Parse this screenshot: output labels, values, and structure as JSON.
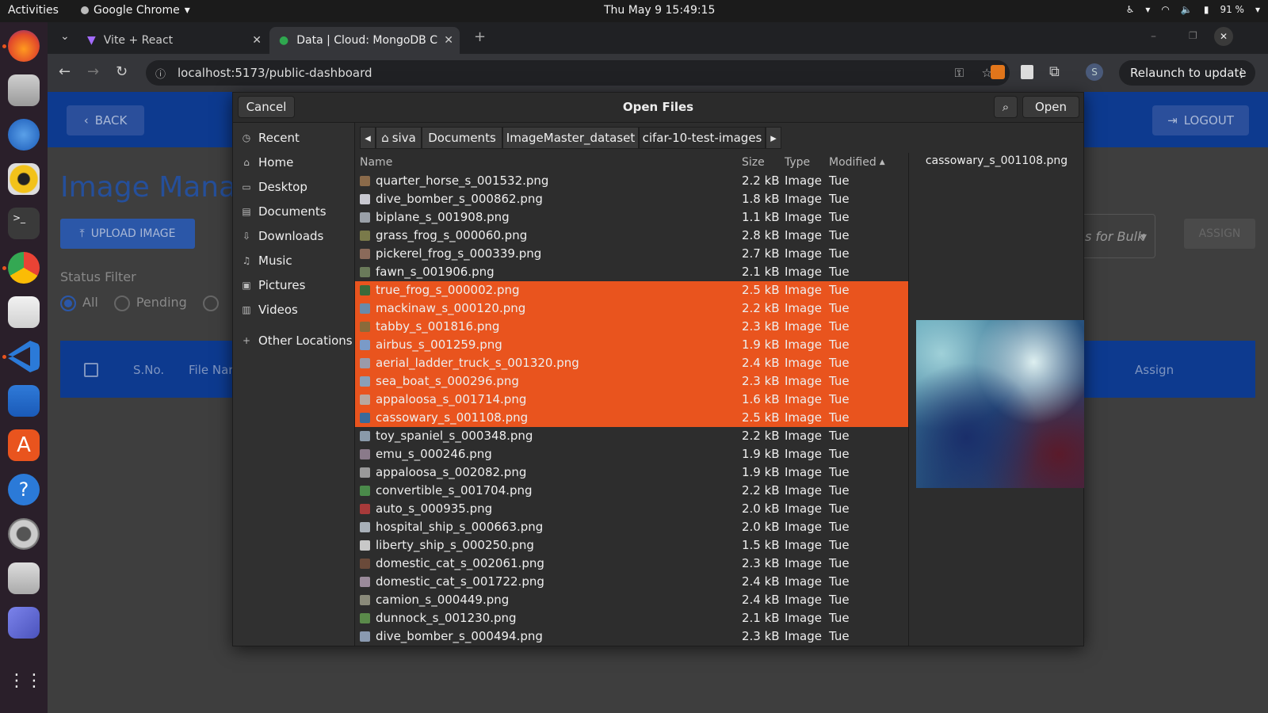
{
  "topbar": {
    "activities": "Activities",
    "app_name": "Google Chrome",
    "clock": "Thu May 9  15:49:15",
    "battery": "91 %"
  },
  "dock": {
    "apps": [
      "firefox",
      "files",
      "thunderbird",
      "rhythmbox",
      "terminal",
      "chrome",
      "screenshot-viewer",
      "vscode",
      "libreoffice-writer",
      "app-center",
      "help",
      "settings",
      "magnifier",
      "teams",
      "show-apps"
    ]
  },
  "chrome": {
    "tabs": [
      {
        "title": "Vite + React"
      },
      {
        "title": "Data | Cloud: MongoDB C"
      }
    ],
    "url": "localhost:5173/public-dashboard",
    "relaunch_label": "Relaunch to update",
    "profile_initial": "S"
  },
  "page": {
    "back_label": "BACK",
    "logout_label": "LOGOUT",
    "title": "Image Manag",
    "upload_label": "UPLOAD IMAGE",
    "status_filter_label": "Status Filter",
    "status_options": [
      "All",
      "Pending",
      ""
    ],
    "bulk_select_text": "s for Bulk",
    "assign_label": "ASSIGN",
    "table_headers": {
      "sno": "S.No.",
      "file_name": "File Nar",
      "assign": "Assign"
    }
  },
  "dialog": {
    "cancel_label": "Cancel",
    "title": "Open Files",
    "open_label": "Open",
    "sidebar": [
      {
        "label": "Recent",
        "icon": "clock-icon"
      },
      {
        "label": "Home",
        "icon": "home-icon"
      },
      {
        "label": "Desktop",
        "icon": "desktop-icon"
      },
      {
        "label": "Documents",
        "icon": "document-icon"
      },
      {
        "label": "Downloads",
        "icon": "download-icon"
      },
      {
        "label": "Music",
        "icon": "music-icon"
      },
      {
        "label": "Pictures",
        "icon": "picture-icon"
      },
      {
        "label": "Videos",
        "icon": "video-icon"
      },
      {
        "label": "Other Locations",
        "icon": "plus-icon"
      }
    ],
    "path": [
      "siva",
      "Documents",
      "ImageMaster_dataset",
      "cifar-10-test-images"
    ],
    "columns": {
      "name": "Name",
      "size": "Size",
      "type": "Type",
      "modified": "Modified"
    },
    "files": [
      {
        "name": "quarter_horse_s_001532.png",
        "size": "2.2 kB",
        "type": "Image",
        "modified": "Tue",
        "selected": false,
        "thumb": "#8a6a4a"
      },
      {
        "name": "dive_bomber_s_000862.png",
        "size": "1.8 kB",
        "type": "Image",
        "modified": "Tue",
        "selected": false,
        "thumb": "#c8c8d0"
      },
      {
        "name": "biplane_s_001908.png",
        "size": "1.1 kB",
        "type": "Image",
        "modified": "Tue",
        "selected": false,
        "thumb": "#9aa0a8"
      },
      {
        "name": "grass_frog_s_000060.png",
        "size": "2.8 kB",
        "type": "Image",
        "modified": "Tue",
        "selected": false,
        "thumb": "#7a7a4a"
      },
      {
        "name": "pickerel_frog_s_000339.png",
        "size": "2.7 kB",
        "type": "Image",
        "modified": "Tue",
        "selected": false,
        "thumb": "#8a6a5a"
      },
      {
        "name": "fawn_s_001906.png",
        "size": "2.1 kB",
        "type": "Image",
        "modified": "Tue",
        "selected": false,
        "thumb": "#6a7a5a"
      },
      {
        "name": "true_frog_s_000002.png",
        "size": "2.5 kB",
        "type": "Image",
        "modified": "Tue",
        "selected": true,
        "thumb": "#3a6a3a"
      },
      {
        "name": "mackinaw_s_000120.png",
        "size": "2.2 kB",
        "type": "Image",
        "modified": "Tue",
        "selected": true,
        "thumb": "#6a8aaa"
      },
      {
        "name": "tabby_s_001816.png",
        "size": "2.3 kB",
        "type": "Image",
        "modified": "Tue",
        "selected": true,
        "thumb": "#8a6a3a"
      },
      {
        "name": "airbus_s_001259.png",
        "size": "1.9 kB",
        "type": "Image",
        "modified": "Tue",
        "selected": true,
        "thumb": "#7a9ac8"
      },
      {
        "name": "aerial_ladder_truck_s_001320.png",
        "size": "2.4 kB",
        "type": "Image",
        "modified": "Tue",
        "selected": true,
        "thumb": "#9a9aaa"
      },
      {
        "name": "sea_boat_s_000296.png",
        "size": "2.3 kB",
        "type": "Image",
        "modified": "Tue",
        "selected": true,
        "thumb": "#8aa0b8"
      },
      {
        "name": "appaloosa_s_001714.png",
        "size": "1.6 kB",
        "type": "Image",
        "modified": "Tue",
        "selected": true,
        "thumb": "#b8a8a0"
      },
      {
        "name": "cassowary_s_001108.png",
        "size": "2.5 kB",
        "type": "Image",
        "modified": "Tue",
        "selected": true,
        "thumb": "#3a6a9a"
      },
      {
        "name": "toy_spaniel_s_000348.png",
        "size": "2.2 kB",
        "type": "Image",
        "modified": "Tue",
        "selected": false,
        "thumb": "#8a9aaa"
      },
      {
        "name": "emu_s_000246.png",
        "size": "1.9 kB",
        "type": "Image",
        "modified": "Tue",
        "selected": false,
        "thumb": "#8a7a8a"
      },
      {
        "name": "appaloosa_s_002082.png",
        "size": "1.9 kB",
        "type": "Image",
        "modified": "Tue",
        "selected": false,
        "thumb": "#9a9a9a"
      },
      {
        "name": "convertible_s_001704.png",
        "size": "2.2 kB",
        "type": "Image",
        "modified": "Tue",
        "selected": false,
        "thumb": "#4a8a4a"
      },
      {
        "name": "auto_s_000935.png",
        "size": "2.0 kB",
        "type": "Image",
        "modified": "Tue",
        "selected": false,
        "thumb": "#a83a3a"
      },
      {
        "name": "hospital_ship_s_000663.png",
        "size": "2.0 kB",
        "type": "Image",
        "modified": "Tue",
        "selected": false,
        "thumb": "#a8b0b8"
      },
      {
        "name": "liberty_ship_s_000250.png",
        "size": "1.5 kB",
        "type": "Image",
        "modified": "Tue",
        "selected": false,
        "thumb": "#c8c8c8"
      },
      {
        "name": "domestic_cat_s_002061.png",
        "size": "2.3 kB",
        "type": "Image",
        "modified": "Tue",
        "selected": false,
        "thumb": "#6a4a3a"
      },
      {
        "name": "domestic_cat_s_001722.png",
        "size": "2.4 kB",
        "type": "Image",
        "modified": "Tue",
        "selected": false,
        "thumb": "#9a8a9a"
      },
      {
        "name": "camion_s_000449.png",
        "size": "2.4 kB",
        "type": "Image",
        "modified": "Tue",
        "selected": false,
        "thumb": "#8a8a7a"
      },
      {
        "name": "dunnock_s_001230.png",
        "size": "2.1 kB",
        "type": "Image",
        "modified": "Tue",
        "selected": false,
        "thumb": "#5a8a4a"
      },
      {
        "name": "dive_bomber_s_000494.png",
        "size": "2.3 kB",
        "type": "Image",
        "modified": "Tue",
        "selected": false,
        "thumb": "#8a9ab0"
      }
    ],
    "preview_name": "cassowary_s_001108.png"
  },
  "colors": {
    "selection": "#e9541e",
    "header_blue": "#0d3a8f",
    "dock_bg": "#2a1f2a"
  }
}
